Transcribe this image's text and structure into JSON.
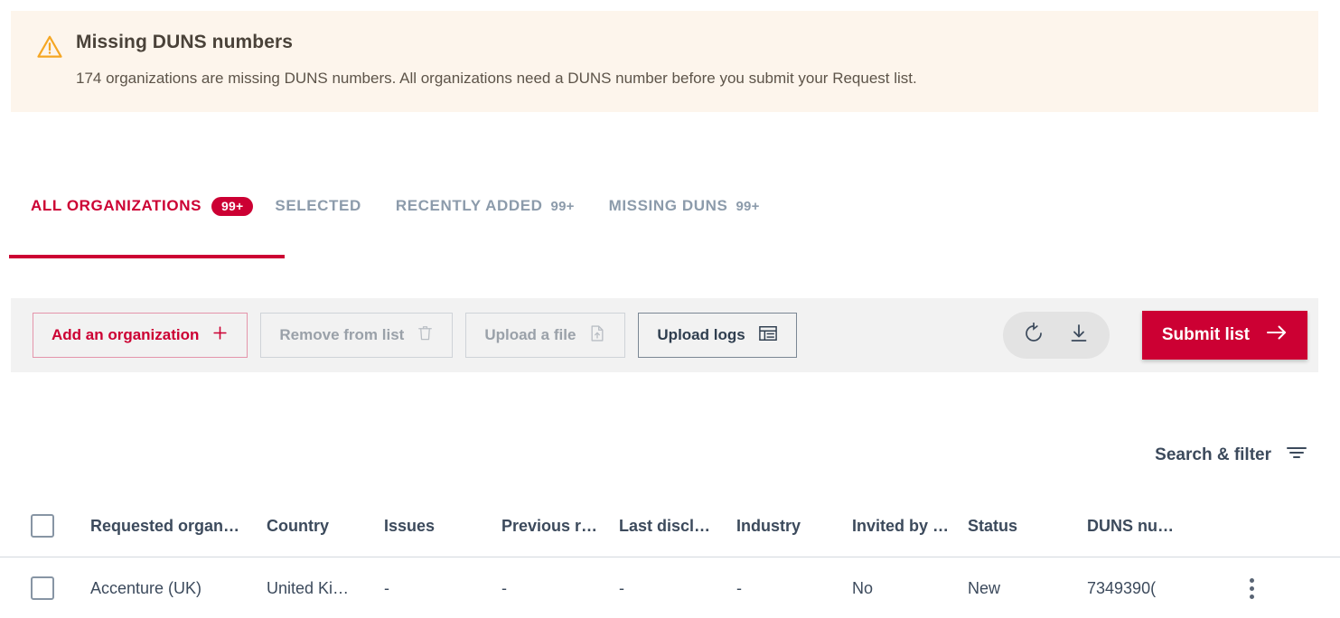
{
  "alert": {
    "icon": "warning-triangle-icon",
    "title": "Missing DUNS numbers",
    "message": "174 organizations are missing DUNS numbers. All organizations need a DUNS number before you submit your Request list.",
    "bg_color": "#fdf5ec",
    "icon_color": "#f5a623"
  },
  "tabs": [
    {
      "label": "ALL ORGANIZATIONS",
      "badge": "99+",
      "active": true
    },
    {
      "label": "SELECTED",
      "badge": "",
      "active": false
    },
    {
      "label": "RECENTLY ADDED",
      "badge": "99+",
      "active": false
    },
    {
      "label": "MISSING DUNS",
      "badge": "99+",
      "active": false
    }
  ],
  "toolbar": {
    "add_label": "Add an organization",
    "add_icon": "plus-icon",
    "remove_label": "Remove from list",
    "remove_icon": "trash-icon",
    "upload_file_label": "Upload a file",
    "upload_file_icon": "file-upload-icon",
    "upload_logs_label": "Upload logs",
    "upload_logs_icon": "table-list-icon",
    "refresh_icon": "refresh-icon",
    "download_icon": "download-icon",
    "submit_label": "Submit list",
    "submit_icon": "arrow-right-icon",
    "accent_color": "#cc0033"
  },
  "search": {
    "label": "Search & filter",
    "icon": "filter-icon"
  },
  "table": {
    "columns": [
      "Requested organ…",
      "Country",
      "Issues",
      "Previous r…",
      "Last discl…",
      "Industry",
      "Invited by …",
      "Status",
      "DUNS nu…"
    ],
    "rows": [
      {
        "organization": "Accenture (UK)",
        "country": "United Ki…",
        "issues": "-",
        "previous_response": "-",
        "last_disclosure": "-",
        "industry": "-",
        "invited_by": "No",
        "status": "New",
        "duns_number": "7349390(",
        "menu_icon": "kebab-menu-icon"
      }
    ]
  }
}
